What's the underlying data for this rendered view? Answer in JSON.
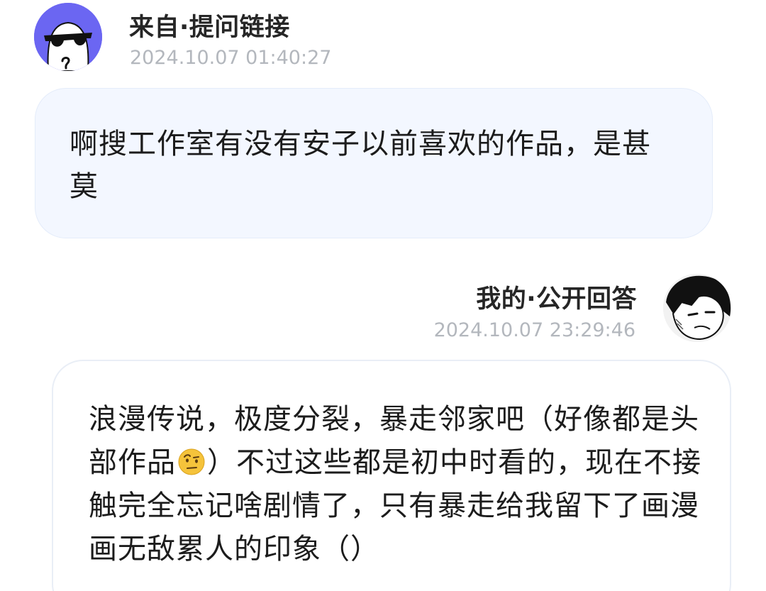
{
  "question": {
    "sender": "来自·提问链接",
    "timestamp": "2024.10.07 01:40:27",
    "text": "啊搜工作室有没有安子以前喜欢的作品，是甚莫",
    "avatar_icon": "sunglasses-face-icon",
    "avatar_color": "#6b66f2",
    "bubble_color": "#f3f7ff"
  },
  "answer": {
    "sender": "我的·公开回答",
    "timestamp": "2024.10.07 23:29:46",
    "text_before_emoji": "浪漫传说，极度分裂，暴走邻家吧（好像都是头部作品",
    "emoji": "raised-eyebrow-face-icon",
    "text_after_emoji": "）不过这些都是初中时看的，现在不接触完全忘记啥剧情了，只有暴走给我留下了画漫画无敌累人的印象（）",
    "avatar_icon": "manga-character-avatar-icon"
  },
  "colors": {
    "timestamp": "#b3b7bd",
    "text": "#1c1c1c"
  }
}
